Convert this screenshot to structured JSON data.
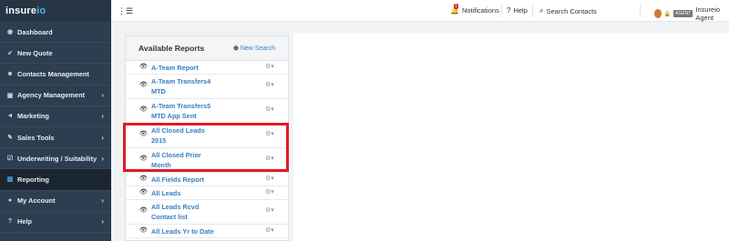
{
  "brand": {
    "logo_main": "insure",
    "logo_accent": "io"
  },
  "sidebar": {
    "items": [
      {
        "label": "Dashboard",
        "icon": "dashboard-icon",
        "glyph": "◉",
        "chevron": false,
        "active": false
      },
      {
        "label": "New Quote",
        "icon": "rocket-icon",
        "glyph": "➶",
        "chevron": false,
        "active": false
      },
      {
        "label": "Contacts Management",
        "icon": "users-icon",
        "glyph": "☻",
        "chevron": false,
        "active": false
      },
      {
        "label": "Agency Management",
        "icon": "briefcase-icon",
        "glyph": "▣",
        "chevron": true,
        "active": false
      },
      {
        "label": "Marketing",
        "icon": "bullhorn-icon",
        "glyph": "◄",
        "chevron": true,
        "active": false
      },
      {
        "label": "Sales Tools",
        "icon": "wrench-icon",
        "glyph": "✎",
        "chevron": true,
        "active": false
      },
      {
        "label": "Underwriting / Suitability",
        "icon": "checkbox-icon",
        "glyph": "☑",
        "chevron": true,
        "active": false
      },
      {
        "label": "Reporting",
        "icon": "bar-chart-icon",
        "glyph": "▥",
        "chevron": false,
        "active": true
      },
      {
        "label": "My Account",
        "icon": "user-icon",
        "glyph": "●",
        "chevron": true,
        "active": false
      },
      {
        "label": "Help",
        "icon": "question-icon",
        "glyph": "?",
        "chevron": true,
        "active": false
      }
    ]
  },
  "topbar": {
    "menu_toggle_glyph": "⋮☰",
    "notifications": {
      "label": "Notifications",
      "count": "1"
    },
    "help": {
      "label": "Help"
    },
    "search": {
      "label": "Search Contacts"
    },
    "user": {
      "tag": "AGENT",
      "name": "Insureio Agent"
    }
  },
  "reports": {
    "title": "Available Reports",
    "new_search_label": "New Search",
    "items": [
      {
        "lines": [
          "A-Team Report"
        ],
        "highlighted": false
      },
      {
        "lines": [
          "A-Team Transfers4",
          "MTD"
        ],
        "highlighted": false
      },
      {
        "lines": [
          "A-Team Transfers5",
          "MTD App Sent"
        ],
        "highlighted": false
      },
      {
        "lines": [
          "All Closed Leads",
          "2015"
        ],
        "highlighted": true
      },
      {
        "lines": [
          "All Closed Prior",
          "Month"
        ],
        "highlighted": true
      },
      {
        "lines": [
          "All Fields Report"
        ],
        "highlighted": false
      },
      {
        "lines": [
          "All Leads"
        ],
        "highlighted": false
      },
      {
        "lines": [
          "All Leads Rcvd",
          "Contact list"
        ],
        "highlighted": false
      },
      {
        "lines": [
          "All Leads Yr to Date"
        ],
        "highlighted": false
      }
    ],
    "row_icon_glyph": "👁",
    "gear_glyph": "⚙▾"
  },
  "colors": {
    "sidebar_bg": "#2c3e50",
    "link": "#3a7fc1",
    "highlight": "#e01b24"
  }
}
